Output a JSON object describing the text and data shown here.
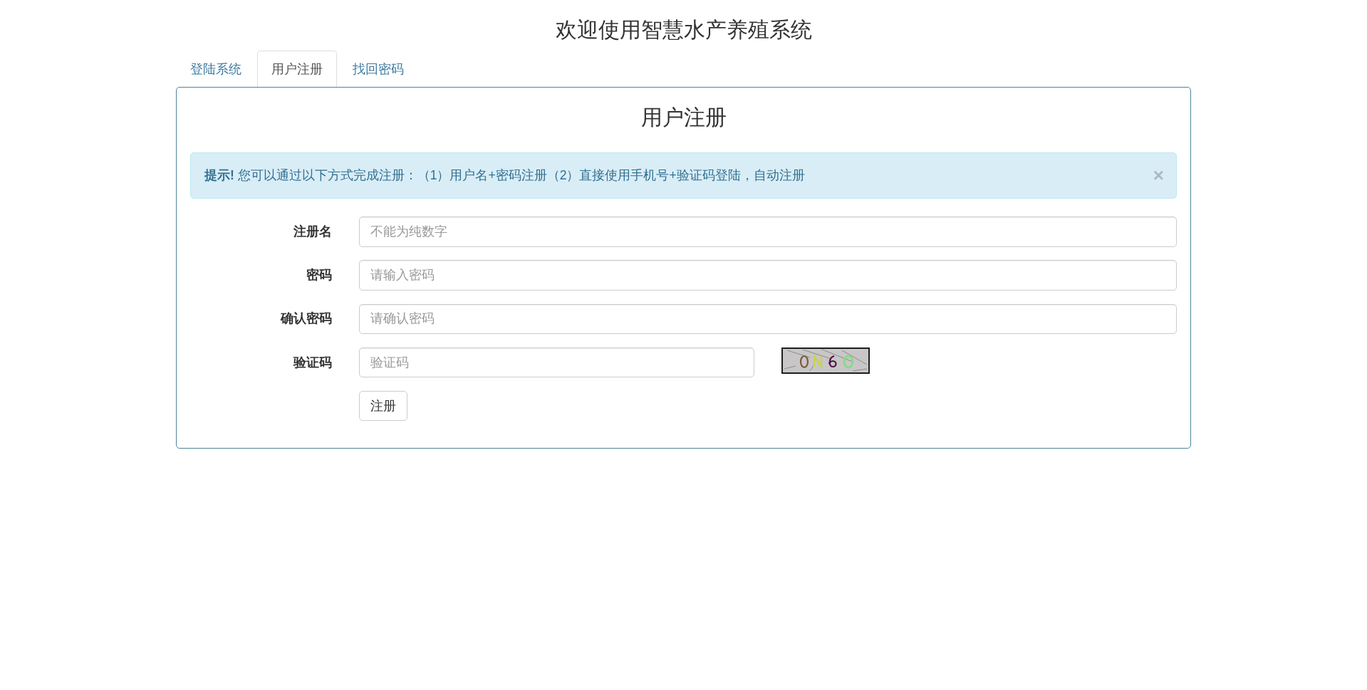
{
  "header": {
    "title": "欢迎使用智慧水产养殖系统"
  },
  "tabs": [
    {
      "label": "登陆系统",
      "selected": false
    },
    {
      "label": "用户注册",
      "selected": true
    },
    {
      "label": "找回密码",
      "selected": false
    }
  ],
  "panel": {
    "heading": "用户注册",
    "alert": {
      "text": "**提示!** 您可以通过以下方式完成注册：（1）用户名+密码注册（2）直接使用手机号+验证码登陆，自动注册",
      "close": "×"
    },
    "fields": [
      {
        "kind": "input",
        "label": "注册名",
        "placeholder": "不能为纯数字"
      },
      {
        "kind": "input",
        "label": "密码",
        "placeholder": "请输入密码"
      },
      {
        "kind": "input",
        "label": "确认密码",
        "placeholder": "请确认密码"
      },
      {
        "kind": "captcha",
        "label": "验证码",
        "placeholder": "验证码"
      }
    ],
    "submit": "注册"
  }
}
